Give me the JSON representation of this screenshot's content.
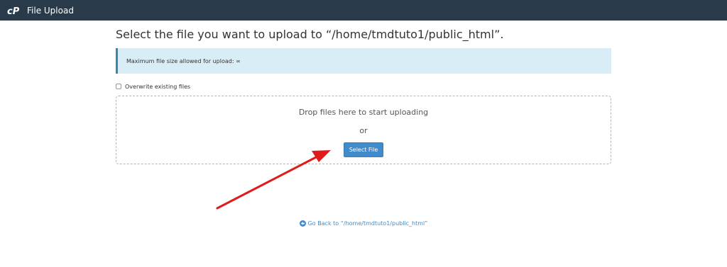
{
  "topbar": {
    "title": "File Upload",
    "logo_icon": "cpanel-logo-icon",
    "background_color": "#293a4a"
  },
  "main": {
    "heading": "Select the file you want to upload to “/home/tmdtuto1/public_html”.",
    "alert": {
      "text": "Maximum file size allowed for upload: ∞",
      "background_color": "#d9edf7",
      "border_color": "#3a87ad"
    },
    "overwrite": {
      "label": "Overwrite existing files",
      "checked": false
    },
    "dropzone": {
      "drop_text": "Drop files here to start uploading",
      "or_text": "or",
      "button_label": "Select File",
      "button_color": "#428bca"
    },
    "annotation": {
      "icon": "red-arrow-annotation",
      "color": "#e01b1b"
    }
  },
  "footer": {
    "back_link": "Go Back to “/home/tmdtuto1/public_html”",
    "back_icon": "circle-arrow-left-icon",
    "link_color": "#428bca"
  }
}
